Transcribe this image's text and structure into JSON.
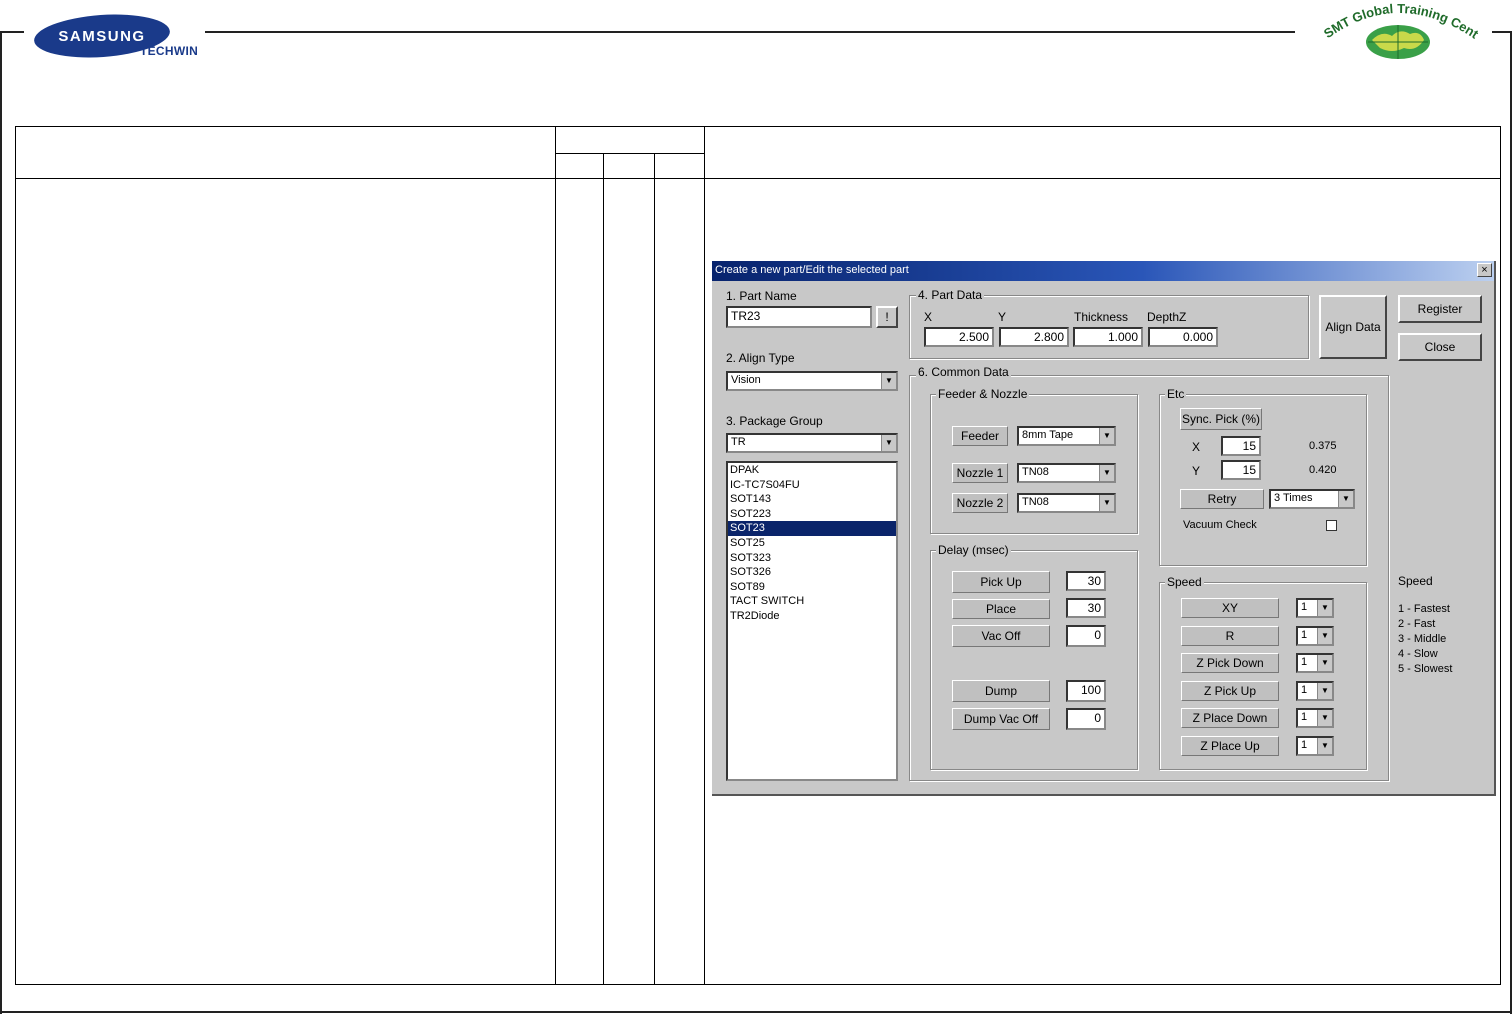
{
  "header": {
    "samsung": "SAMSUNG",
    "techwin": "TECHWIN",
    "training_center": "SMT Global Training Center"
  },
  "dialog": {
    "title": "Create a new part/Edit the selected part",
    "close_glyph": "×",
    "part_name": {
      "label": "1. Part Name",
      "value": "TR23",
      "button": "!"
    },
    "align_type": {
      "label": "2. Align Type",
      "value": "Vision"
    },
    "package_group": {
      "label": "3. Package Group",
      "value": "TR",
      "items": [
        "DPAK",
        "IC-TC7S04FU",
        "SOT143",
        "SOT223",
        "SOT23",
        "SOT25",
        "SOT323",
        "SOT326",
        "SOT89",
        "TACT SWITCH",
        "TR2Diode"
      ],
      "selected": "SOT23"
    },
    "part_data": {
      "label": "4. Part Data",
      "x_label": "X",
      "y_label": "Y",
      "thickness_label": "Thickness",
      "depthz_label": "DepthZ",
      "x": "2.500",
      "y": "2.800",
      "thickness": "1.000",
      "depthz": "0.000"
    },
    "buttons": {
      "align_data": "Align Data",
      "register": "Register",
      "close": "Close"
    },
    "common_data": {
      "label": "6. Common Data",
      "feeder_nozzle": {
        "label": "Feeder & Nozzle",
        "feeder_label": "Feeder",
        "feeder_value": "8mm Tape",
        "nozzle1_label": "Nozzle 1",
        "nozzle1_value": "TN08",
        "nozzle2_label": "Nozzle 2",
        "nozzle2_value": "TN08"
      },
      "etc": {
        "label": "Etc",
        "sync_pick_label": "Sync. Pick (%)",
        "x_label": "X",
        "x_value": "15",
        "x_calc": "0.375",
        "y_label": "Y",
        "y_value": "15",
        "y_calc": "0.420",
        "retry_label": "Retry",
        "retry_value": "3 Times",
        "vacuum_check_label": "Vacuum Check"
      },
      "delay": {
        "label": "Delay (msec)",
        "pick_up_label": "Pick Up",
        "pick_up": "30",
        "place_label": "Place",
        "place": "30",
        "vac_off_label": "Vac Off",
        "vac_off": "0",
        "dump_label": "Dump",
        "dump": "100",
        "dump_vac_off_label": "Dump Vac Off",
        "dump_vac_off": "0"
      },
      "speed": {
        "label": "Speed",
        "rows": [
          {
            "label": "XY",
            "value": "1"
          },
          {
            "label": "R",
            "value": "1"
          },
          {
            "label": "Z Pick Down",
            "value": "1"
          },
          {
            "label": "Z Pick Up",
            "value": "1"
          },
          {
            "label": "Z Place Down",
            "value": "1"
          },
          {
            "label": "Z Place Up",
            "value": "1"
          }
        ]
      }
    },
    "speed_legend": {
      "title": "Speed",
      "items": [
        "1 - Fastest",
        "2 - Fast",
        "3 - Middle",
        "4 - Slow",
        "5 - Slowest"
      ]
    }
  },
  "colors": {
    "titlebar": "#07236d",
    "selection": "#0a246a",
    "dialog_bg": "#c8c8c8",
    "samsung_blue": "#1a3a8a"
  }
}
